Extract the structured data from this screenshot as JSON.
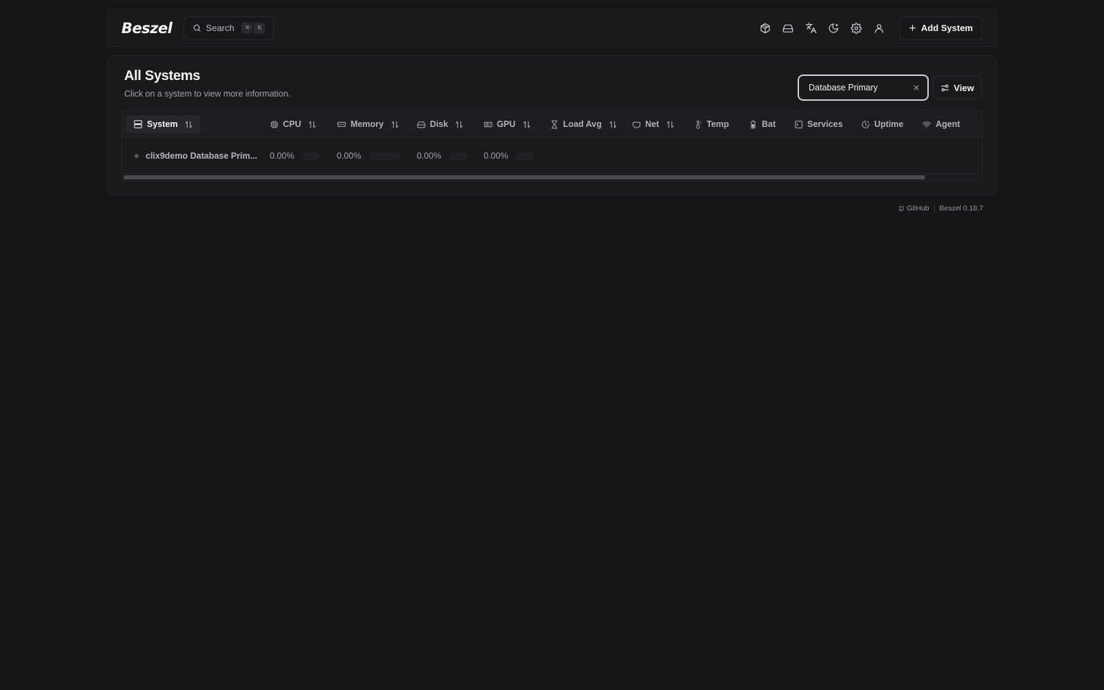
{
  "navbar": {
    "logo": "Beszel",
    "search_label": "Search",
    "search_shortcut": [
      "⌘",
      "K"
    ],
    "icons": [
      "containers-icon",
      "disk-icon",
      "language-icon",
      "theme-moon-icon",
      "settings-gear-icon",
      "user-icon"
    ],
    "add_system_label": "Add System"
  },
  "main": {
    "title": "All Systems",
    "subtitle": "Click on a system to view more information.",
    "filter_value": "Database Primary",
    "view_label": "View"
  },
  "table": {
    "columns": [
      {
        "label": "System",
        "icon": "server-icon",
        "sortable": true
      },
      {
        "label": "CPU",
        "icon": "cpu-icon",
        "sortable": true
      },
      {
        "label": "Memory",
        "icon": "memory-icon",
        "sortable": true
      },
      {
        "label": "Disk",
        "icon": "disk-icon",
        "sortable": true
      },
      {
        "label": "GPU",
        "icon": "gpu-icon",
        "sortable": true
      },
      {
        "label": "Load Avg",
        "icon": "hourglass-icon",
        "sortable": true
      },
      {
        "label": "Net",
        "icon": "network-icon",
        "sortable": true
      },
      {
        "label": "Temp",
        "icon": "thermometer-icon",
        "sortable": false
      },
      {
        "label": "Bat",
        "icon": "battery-icon",
        "sortable": false
      },
      {
        "label": "Services",
        "icon": "terminal-icon",
        "sortable": false
      },
      {
        "label": "Uptime",
        "icon": "clock-icon",
        "sortable": false
      },
      {
        "label": "Agent",
        "icon": "wifi-icon",
        "sortable": false
      }
    ],
    "rows": [
      {
        "system": "clix9demo Database Prim...",
        "status": "down",
        "cpu": "0.00%",
        "memory": "0.00%",
        "disk": "0.00%",
        "gpu": "0.00%"
      }
    ]
  },
  "footer": {
    "github_label": "GitHub",
    "version": "Beszel 0.18.7"
  },
  "colors": {
    "background": "#161618",
    "surface": "#1a1a1d",
    "border": "#242428",
    "text": "#f4f4f5",
    "muted": "#a1a1aa",
    "status_down": "#55555c"
  }
}
